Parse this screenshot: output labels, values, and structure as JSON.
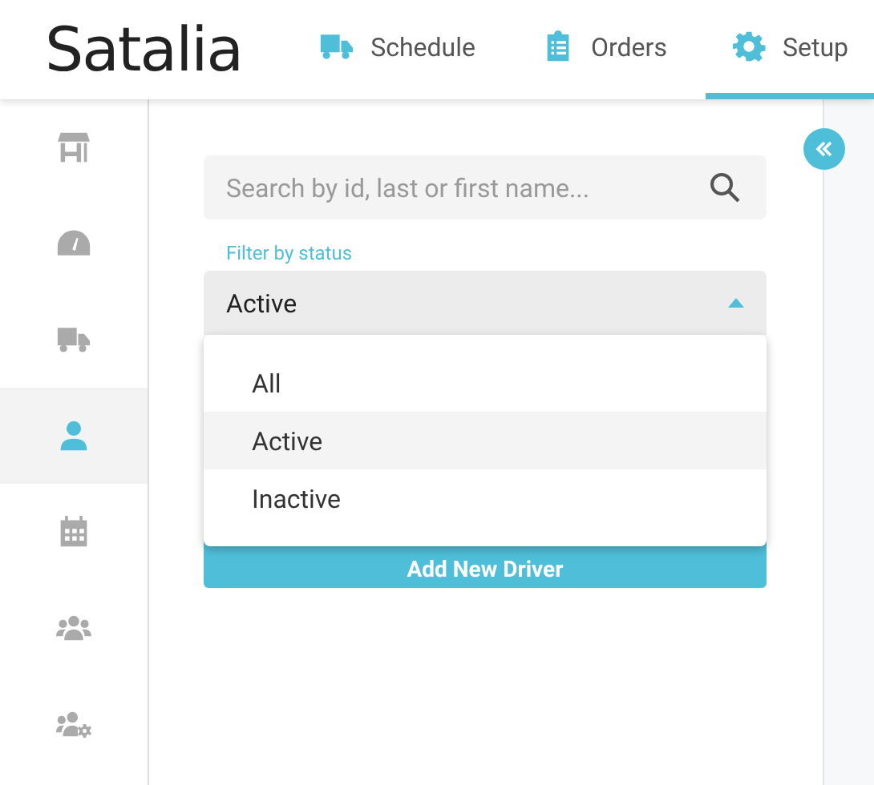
{
  "logo": "Satalia",
  "nav": [
    {
      "label": "Schedule",
      "selected": false
    },
    {
      "label": "Orders",
      "selected": false
    },
    {
      "label": "Setup",
      "selected": true
    }
  ],
  "sidebar": {
    "items": [
      {
        "selected": false
      },
      {
        "selected": false
      },
      {
        "selected": false
      },
      {
        "selected": true
      },
      {
        "selected": false
      },
      {
        "selected": false
      },
      {
        "selected": false
      }
    ]
  },
  "search": {
    "placeholder": "Search by id, last or first name..."
  },
  "filter": {
    "label": "Filter by status",
    "value": "Active",
    "expanded": true,
    "options": [
      {
        "label": "All",
        "selected": false
      },
      {
        "label": "Active",
        "selected": true
      },
      {
        "label": "Inactive",
        "selected": false
      }
    ]
  },
  "add_button": "Add New Driver"
}
